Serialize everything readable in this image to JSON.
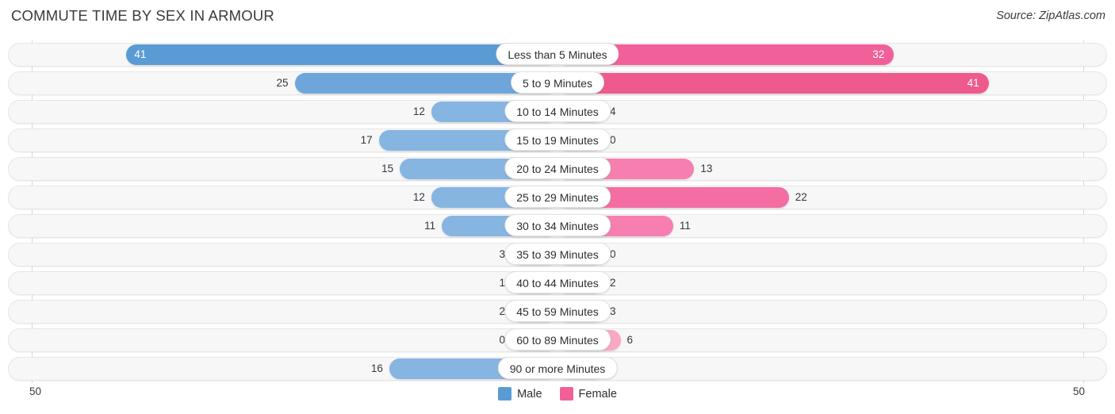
{
  "header": {
    "title": "COMMUTE TIME BY SEX IN ARMOUR",
    "source": "Source: ZipAtlas.com"
  },
  "axis": {
    "left_tick": "50",
    "right_tick": "50"
  },
  "legend": {
    "items": [
      {
        "label": "Male",
        "color": "#5b9bd5"
      },
      {
        "label": "Female",
        "color": "#f2609a"
      }
    ]
  },
  "chart_data": {
    "type": "bar",
    "title": "COMMUTE TIME BY SEX IN ARMOUR",
    "orientation": "horizontal-diverging",
    "xlabel": "",
    "ylabel": "",
    "xlim": [
      50,
      50
    ],
    "grid": false,
    "legend_position": "bottom-center",
    "categories": [
      "Less than 5 Minutes",
      "5 to 9 Minutes",
      "10 to 14 Minutes",
      "15 to 19 Minutes",
      "20 to 24 Minutes",
      "25 to 29 Minutes",
      "30 to 34 Minutes",
      "35 to 39 Minutes",
      "40 to 44 Minutes",
      "45 to 59 Minutes",
      "60 to 89 Minutes",
      "90 or more Minutes"
    ],
    "series": [
      {
        "name": "Male",
        "direction": "left",
        "values": [
          41,
          25,
          12,
          17,
          15,
          12,
          11,
          3,
          1,
          2,
          0,
          16
        ]
      },
      {
        "name": "Female",
        "direction": "right",
        "values": [
          32,
          41,
          4,
          0,
          13,
          22,
          11,
          0,
          2,
          3,
          6,
          0
        ]
      }
    ]
  },
  "rows": [
    {
      "label": "Less than 5 Minutes",
      "male": "41",
      "female": "32",
      "male_v": 41,
      "female_v": 32
    },
    {
      "label": "5 to 9 Minutes",
      "male": "25",
      "female": "41",
      "male_v": 25,
      "female_v": 41
    },
    {
      "label": "10 to 14 Minutes",
      "male": "12",
      "female": "4",
      "male_v": 12,
      "female_v": 4
    },
    {
      "label": "15 to 19 Minutes",
      "male": "17",
      "female": "0",
      "male_v": 17,
      "female_v": 0
    },
    {
      "label": "20 to 24 Minutes",
      "male": "15",
      "female": "13",
      "male_v": 15,
      "female_v": 13
    },
    {
      "label": "25 to 29 Minutes",
      "male": "12",
      "female": "22",
      "male_v": 12,
      "female_v": 22
    },
    {
      "label": "30 to 34 Minutes",
      "male": "11",
      "female": "11",
      "male_v": 11,
      "female_v": 11
    },
    {
      "label": "35 to 39 Minutes",
      "male": "3",
      "female": "0",
      "male_v": 3,
      "female_v": 0
    },
    {
      "label": "40 to 44 Minutes",
      "male": "1",
      "female": "2",
      "male_v": 1,
      "female_v": 2
    },
    {
      "label": "45 to 59 Minutes",
      "male": "2",
      "female": "3",
      "male_v": 2,
      "female_v": 3
    },
    {
      "label": "60 to 89 Minutes",
      "male": "0",
      "female": "6",
      "male_v": 0,
      "female_v": 6
    },
    {
      "label": "90 or more Minutes",
      "male": "16",
      "female": "0",
      "male_v": 16,
      "female_v": 0
    }
  ]
}
